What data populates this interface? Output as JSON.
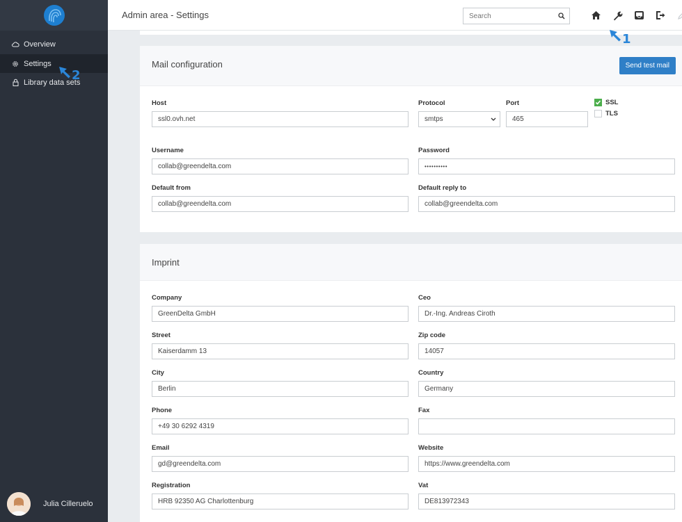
{
  "sidebar": {
    "items": [
      {
        "label": "Overview",
        "icon": "cloud-icon"
      },
      {
        "label": "Settings",
        "icon": "gear-icon",
        "active": true
      },
      {
        "label": "Library data sets",
        "icon": "lock-icon"
      }
    ],
    "user": {
      "name": "Julia Cilleruelo"
    }
  },
  "header": {
    "title": "Admin area - Settings",
    "search_placeholder": "Search",
    "tools": [
      "home-icon",
      "wrench-icon",
      "inbox-icon",
      "sign-out-icon",
      "pencil-icon"
    ]
  },
  "annotations": {
    "first": "1",
    "second": "2"
  },
  "mail": {
    "title": "Mail configuration",
    "send_test_label": "Send test mail",
    "host": {
      "label": "Host",
      "value": "ssl0.ovh.net"
    },
    "protocol": {
      "label": "Protocol",
      "value": "smtps"
    },
    "port": {
      "label": "Port",
      "value": "465"
    },
    "ssl": {
      "label": "SSL",
      "checked": true
    },
    "tls": {
      "label": "TLS",
      "checked": false
    },
    "username": {
      "label": "Username",
      "value": "collab@greendelta.com"
    },
    "password": {
      "label": "Password",
      "value": "••••••••••"
    },
    "default_from": {
      "label": "Default from",
      "value": "collab@greendelta.com"
    },
    "default_reply_to": {
      "label": "Default reply to",
      "value": "collab@greendelta.com"
    }
  },
  "imprint": {
    "title": "Imprint",
    "company": {
      "label": "Company",
      "value": "GreenDelta GmbH"
    },
    "ceo": {
      "label": "Ceo",
      "value": "Dr.-Ing. Andreas Ciroth"
    },
    "street": {
      "label": "Street",
      "value": "Kaiserdamm 13"
    },
    "zip": {
      "label": "Zip code",
      "value": "14057"
    },
    "city": {
      "label": "City",
      "value": "Berlin"
    },
    "country": {
      "label": "Country",
      "value": "Germany"
    },
    "phone": {
      "label": "Phone",
      "value": "+49 30 6292 4319"
    },
    "fax": {
      "label": "Fax",
      "value": ""
    },
    "email": {
      "label": "Email",
      "value": "gd@greendelta.com"
    },
    "website": {
      "label": "Website",
      "value": "https://www.greendelta.com"
    },
    "registration": {
      "label": "Registration",
      "value": "HRB 92350 AG Charlottenburg"
    },
    "vat": {
      "label": "Vat",
      "value": "DE813972343"
    }
  },
  "colors": {
    "sidebar": "#2b313b",
    "accent": "#2f7fc7",
    "annotation": "#2b86d8",
    "check": "#4cae4c"
  }
}
